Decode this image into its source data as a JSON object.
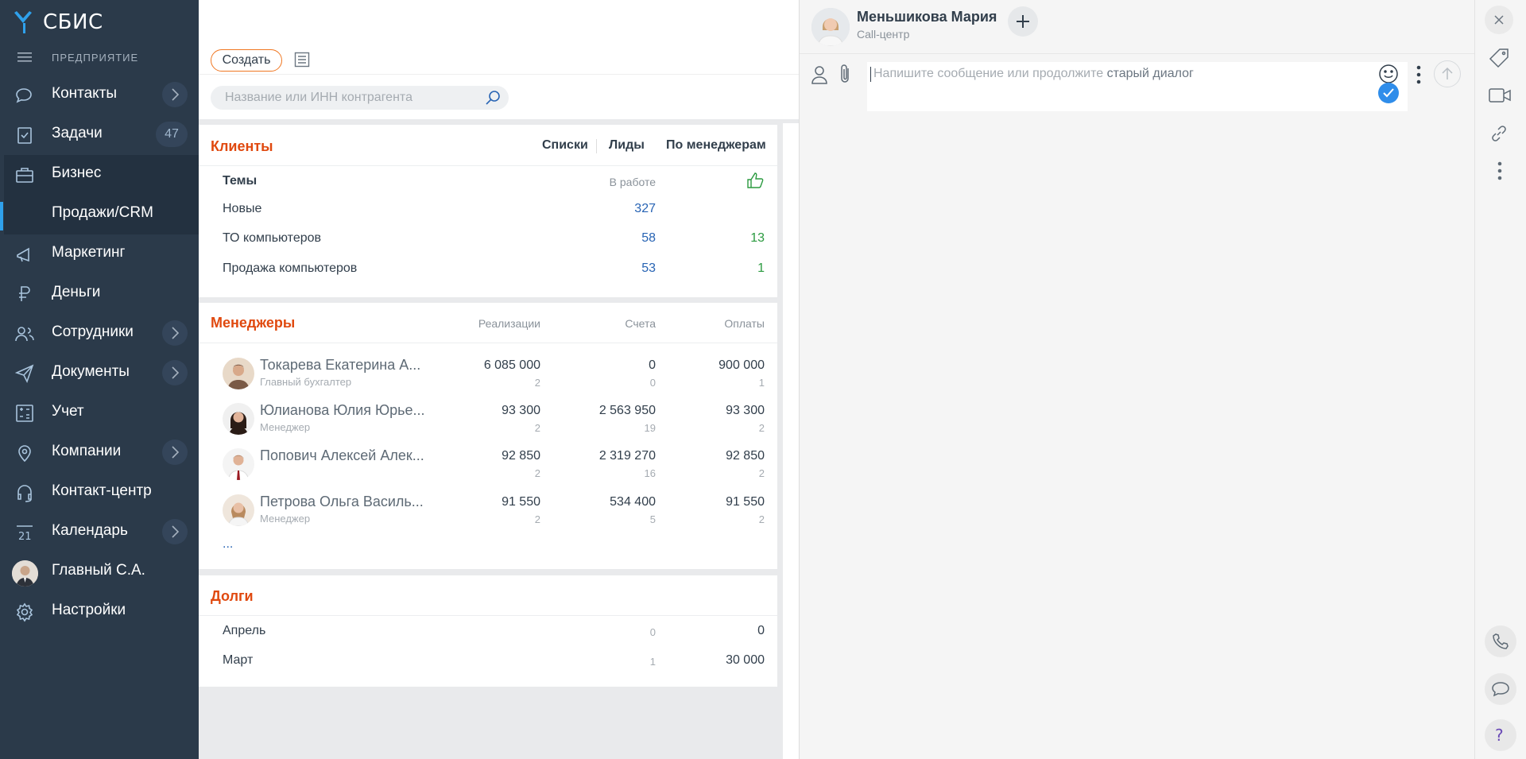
{
  "app": {
    "logo": "СБИС",
    "company": "ПРЕДПРИЯТИЕ"
  },
  "nav": {
    "items": [
      {
        "label": "Контакты"
      },
      {
        "label": "Задачи",
        "count": "47"
      },
      {
        "label": "Бизнес"
      },
      {
        "label": "Продажи/CRM"
      },
      {
        "label": "Маркетинг"
      },
      {
        "label": "Деньги"
      },
      {
        "label": "Сотрудники"
      },
      {
        "label": "Документы"
      },
      {
        "label": "Учет"
      },
      {
        "label": "Компании"
      },
      {
        "label": "Контакт-центр"
      },
      {
        "label": "Календарь"
      },
      {
        "label": "Главный С.А."
      },
      {
        "label": "Настройки"
      }
    ]
  },
  "toolbar": {
    "create_label": "Создать",
    "search_placeholder": "Название или ИНН контрагента"
  },
  "clients": {
    "title": "Клиенты",
    "tabs": [
      "Списки",
      "Лиды",
      "По менеджерам"
    ],
    "themes_label": "Темы",
    "in_work_label": "В работе",
    "rows": [
      {
        "name": "Новые",
        "in_work": "327",
        "liked": ""
      },
      {
        "name": "ТО компьютеров",
        "in_work": "58",
        "liked": "13"
      },
      {
        "name": "Продажа компьютеров",
        "in_work": "53",
        "liked": "1"
      }
    ]
  },
  "managers": {
    "title": "Менеджеры",
    "col_realizations": "Реализации",
    "col_invoices": "Счета",
    "col_payments": "Оплаты",
    "rows": [
      {
        "name": "Токарева Екатерина А...",
        "role": "Главный бухгалтер",
        "real": "6 085 000",
        "real_cnt": "2",
        "inv": "0",
        "inv_cnt": "0",
        "pay": "900 000",
        "pay_cnt": "1"
      },
      {
        "name": "Юлианова Юлия Юрье...",
        "role": "Менеджер",
        "real": "93 300",
        "real_cnt": "2",
        "inv": "2 563 950",
        "inv_cnt": "19",
        "pay": "93 300",
        "pay_cnt": "2"
      },
      {
        "name": "Попович Алексей Алек...",
        "role": "",
        "real": "92 850",
        "real_cnt": "2",
        "inv": "2 319 270",
        "inv_cnt": "16",
        "pay": "92 850",
        "pay_cnt": "2"
      },
      {
        "name": "Петрова Ольга Василь...",
        "role": "Менеджер",
        "real": "91 550",
        "real_cnt": "2",
        "inv": "534 400",
        "inv_cnt": "5",
        "pay": "91 550",
        "pay_cnt": "2"
      }
    ],
    "more": "..."
  },
  "debts": {
    "title": "Долги",
    "rows": [
      {
        "month": "Апрель",
        "count": "0",
        "amount": "0"
      },
      {
        "month": "Март",
        "count": "1",
        "amount": "30 000"
      }
    ]
  },
  "chat": {
    "name": "Меньшикова Мария",
    "subtitle": "Call-центр",
    "placeholder": "Напишите сообщение или продолжите",
    "placeholder_link": "старый диалог"
  },
  "colors": {
    "sidebar": "#2b3a4a",
    "accent_red": "#e0490f",
    "link_blue": "#2864b4",
    "green": "#2a9a3f",
    "check_blue": "#2f8dea"
  }
}
